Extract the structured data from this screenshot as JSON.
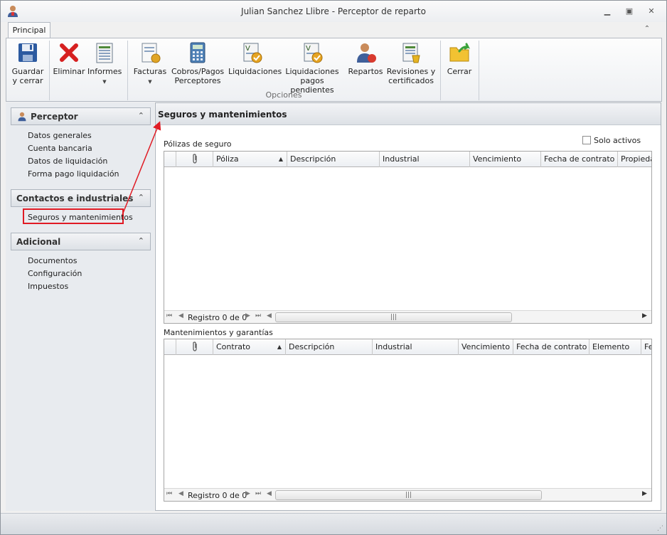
{
  "window": {
    "title": "Julian Sanchez Llibre - Perceptor de reparto"
  },
  "ribbon": {
    "tab": "Principal",
    "buttons": {
      "save": [
        "Guardar",
        "y cerrar"
      ],
      "delete": [
        "Eliminar"
      ],
      "reports": [
        "Informes"
      ],
      "invoices": [
        "Facturas"
      ],
      "payments": [
        "Cobros/Pagos",
        "Perceptores"
      ],
      "settlements": [
        "Liquidaciones"
      ],
      "pending": [
        "Liquidaciones",
        "pagos pendientes"
      ],
      "distributions": [
        "Repartos"
      ],
      "reviews": [
        "Revisiones y",
        "certificados"
      ],
      "close": [
        "Cerrar"
      ]
    },
    "group_label": "Opciones"
  },
  "sidebar": {
    "groups": [
      {
        "title": "Perceptor",
        "items": [
          "Datos generales",
          "Cuenta bancaria",
          "Datos de liquidación",
          "Forma pago liquidación"
        ]
      },
      {
        "title": "Contactos e industriales",
        "items": [
          "Seguros y mantenimientos"
        ]
      },
      {
        "title": "Adicional",
        "items": [
          "Documentos",
          "Configuración",
          "Impuestos"
        ]
      }
    ]
  },
  "main": {
    "title": "Seguros y mantenimientos",
    "policies": {
      "label": "Pólizas de seguro",
      "only_active": "Solo activos",
      "columns": [
        "Póliza",
        "Descripción",
        "Industrial",
        "Vencimiento",
        "Fecha de contrato",
        "Propiedad"
      ],
      "record_text": "Registro 0 de 0"
    },
    "maintenance": {
      "label": "Mantenimientos y garantías",
      "columns": [
        "Contrato",
        "Descripción",
        "Industrial",
        "Vencimiento",
        "Fecha de contrato",
        "Elemento",
        "Fecha"
      ],
      "record_text": "Registro 0 de 0"
    }
  },
  "colors": {
    "highlight": "#e01b24",
    "accent": "#2e6fb8"
  },
  "icons": [
    "app-user-icon",
    "save-icon",
    "delete-icon",
    "reports-icon",
    "invoices-icon",
    "calculator-icon",
    "settlement-icon",
    "pending-settlement-icon",
    "users-icon",
    "certificates-icon",
    "close-folder-icon",
    "paperclip-icon"
  ]
}
